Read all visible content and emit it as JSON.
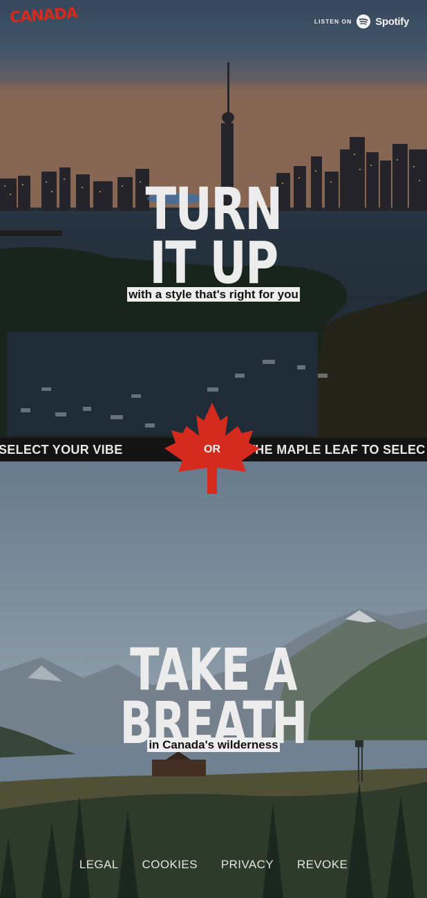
{
  "header": {
    "logo_text": "CANADA",
    "spotify": {
      "listen_label": "LISTEN ON",
      "brand": "Spotify"
    }
  },
  "section_top": {
    "title_line1": "TURN",
    "title_line2": "IT UP",
    "subtitle": "with a style that's right for you"
  },
  "marquee": {
    "left_text": "SELECT YOUR VIBE",
    "right_text": "THE MAPLE LEAF TO SELEC",
    "button_label": "OR"
  },
  "section_bottom": {
    "title_line1": "TAKE A",
    "title_line2": "BREATH",
    "subtitle": "in Canada's wilderness"
  },
  "footer": {
    "links": [
      "LEGAL",
      "COOKIES",
      "PRIVACY",
      "REVOKE"
    ]
  },
  "colors": {
    "brand_red": "#d52b1e",
    "band_bg": "#141414",
    "tag_bg": "#eeeeee"
  },
  "icons": [
    "maple-leaf-icon",
    "spotify-icon"
  ]
}
